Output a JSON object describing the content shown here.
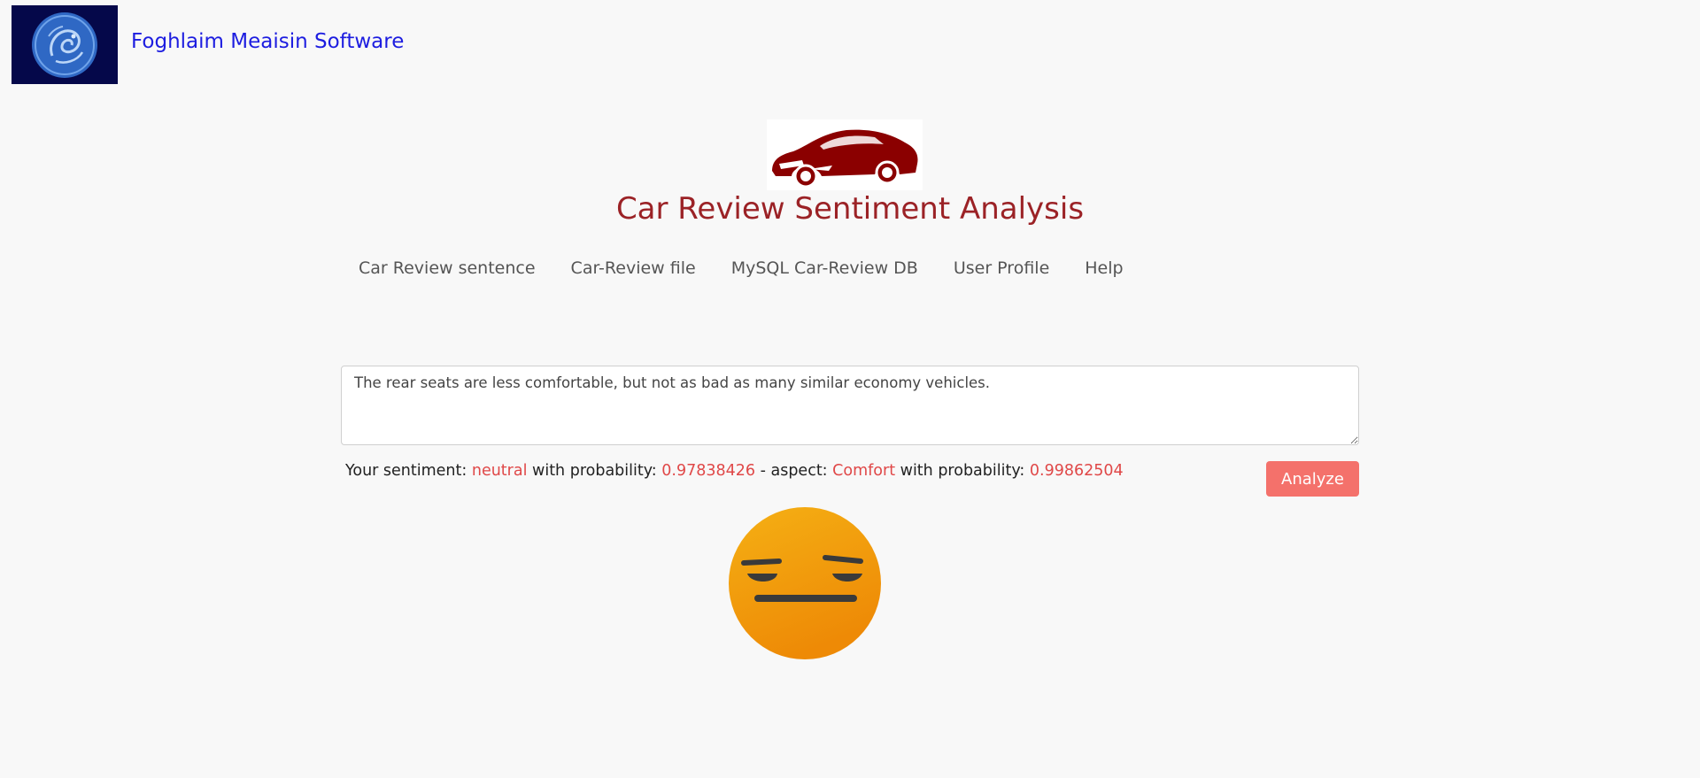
{
  "brand": {
    "name": "Foghlaim Meaisin Software",
    "logo_icon": "phoenix-circle-logo-icon",
    "logo_bg": "#05084a"
  },
  "hero": {
    "image_icon": "sports-car-icon",
    "car_color": "#8b0000"
  },
  "page": {
    "title": "Car Review Sentiment Analysis"
  },
  "nav": {
    "items": [
      {
        "label": "Car Review sentence"
      },
      {
        "label": "Car-Review file"
      },
      {
        "label": "MySQL Car-Review DB"
      },
      {
        "label": "User Profile"
      },
      {
        "label": "Help"
      }
    ]
  },
  "review": {
    "text": "The rear seats are less comfortable, but not as bad as many similar economy vehicles."
  },
  "result": {
    "prefix": "Your sentiment: ",
    "sentiment": "neutral",
    "with_probability": " with probability: ",
    "sentiment_probability": "0.97838426",
    "aspect_label": " - aspect: ",
    "aspect": "Comfort",
    "with_probability_2": " with probability: ",
    "aspect_probability": "0.99862504"
  },
  "actions": {
    "analyze_label": "Analyze"
  },
  "emoji": {
    "icon": "neutral-face-emoji-icon"
  },
  "colors": {
    "accent": "#e04848",
    "button": "#f4716b",
    "title": "#9b2226",
    "brand_link": "#1d1de0"
  }
}
